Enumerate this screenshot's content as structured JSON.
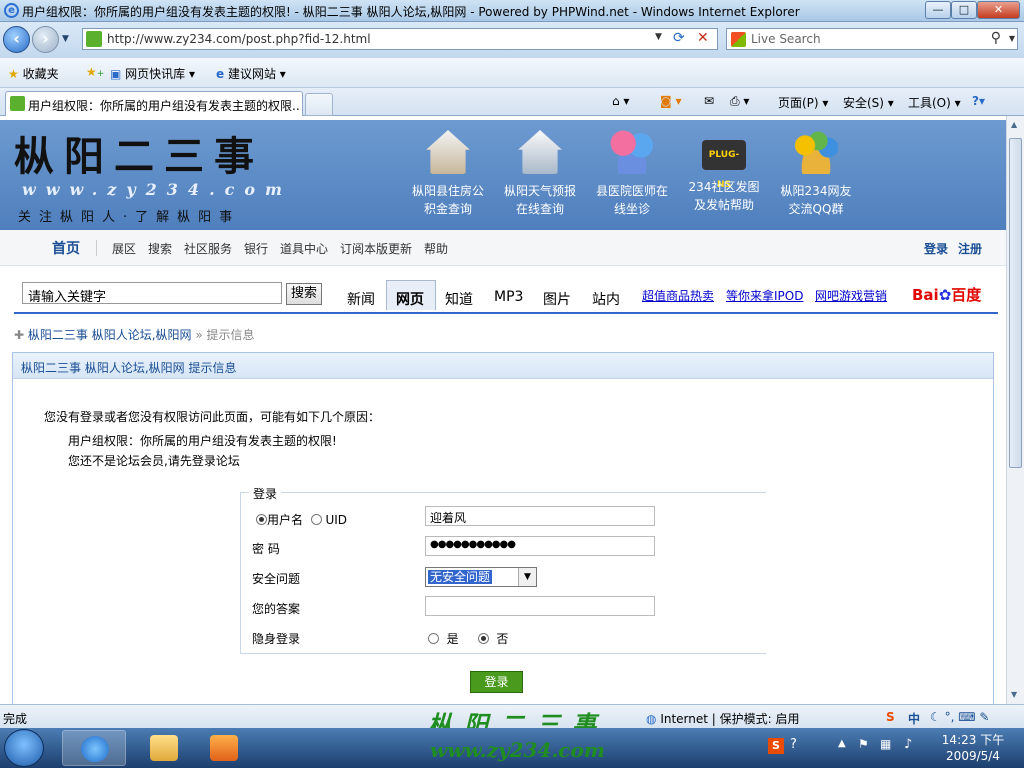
{
  "window": {
    "title": "用户组权限：你所属的用户组没有发表主题的权限! - 枞阳二三事 枞阳人论坛,枞阳网 - Powered by PHPWind.net - Windows Internet Explorer",
    "min": "—",
    "max": "□",
    "close": "✕"
  },
  "address": {
    "url": "http://www.zy234.com/post.php?fid-12.html",
    "search_placeholder": "Live Search"
  },
  "favorites": {
    "fav_label": "收藏夹",
    "item1": "网页快讯库 ▾",
    "item2": "建议网站 ▾"
  },
  "tab": {
    "label": "用户组权限：你所属的用户组没有发表主题的权限..."
  },
  "commands": {
    "page": "页面(P) ▾",
    "safety": "安全(S) ▾",
    "tools": "工具(O) ▾"
  },
  "site": {
    "logo_cn": "枞阳二三事",
    "logo_url": "www.zy234.com",
    "slogan": "关注枞阳人·了解枞阳事",
    "banner_links": [
      {
        "l1": "枞阳县住房公",
        "l2": "积金查询"
      },
      {
        "l1": "枞阳天气预报",
        "l2": "在线查询"
      },
      {
        "l1": "县医院医师在",
        "l2": "线坐诊"
      },
      {
        "l1": "234社区发图",
        "l2": "及发帖帮助"
      },
      {
        "l1": "枞阳234网友",
        "l2": "交流QQ群"
      }
    ],
    "plugin_text": "PLUG-NS"
  },
  "nav": {
    "home": "首页",
    "items": [
      "展区",
      "搜索",
      "社区服务",
      "银行",
      "道具中心",
      "订阅本版更新",
      "帮助"
    ],
    "login": "登录",
    "register": "注册"
  },
  "search": {
    "input": "请输入关键字",
    "button": "搜索",
    "tabs": [
      "新闻",
      "网页",
      "知道",
      "MP3",
      "图片",
      "站内"
    ],
    "links": [
      "超值商品热卖",
      "等你来拿IPOD",
      "网吧游戏营销"
    ],
    "baidu_a": "Bai",
    "baidu_b": "百度"
  },
  "breadcrumb": {
    "forum": "枞阳二三事 枞阳人论坛,枞阳网",
    "sep": "»",
    "current": "提示信息"
  },
  "panel": {
    "head": "枞阳二三事 枞阳人论坛,枞阳网 提示信息",
    "msg1": "您没有登录或者您没有权限访问此页面，可能有如下几个原因：",
    "msg2": "用户组权限：你所属的用户组没有发表主题的权限!",
    "msg3": "您还不是论坛会员,请先登录论坛"
  },
  "login": {
    "legend": "登录",
    "opt_username": "用户名",
    "opt_uid": "UID",
    "username_value": "迎着风",
    "password_label": "密  码",
    "password_value": "●●●●●●●●●●●",
    "question_label": "安全问题",
    "question_value": "无安全问题",
    "answer_label": "您的答案",
    "hidden_label": "隐身登录",
    "yes": "是",
    "no": "否",
    "submit": "登录"
  },
  "status": {
    "left": "完成",
    "zone": "Internet | 保护模式: 启用",
    "watermark": "枞阳二三事",
    "watermark_url": "www.zy234.com"
  },
  "taskbar": {
    "time": "14:23 下午",
    "date": "2009/5/4",
    "ime": "中"
  }
}
